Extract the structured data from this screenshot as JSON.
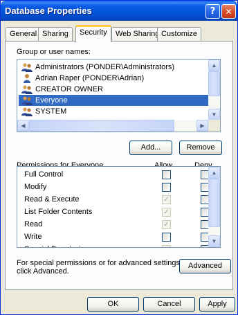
{
  "window": {
    "title": "Database Properties"
  },
  "titlebar": {
    "help_glyph": "?",
    "close_glyph": "✕"
  },
  "tabs": [
    "General",
    "Sharing",
    "Security",
    "Web Sharing",
    "Customize"
  ],
  "active_tab": "Security",
  "groups": {
    "label": "Group or user names:",
    "items": [
      {
        "name": "Administrators (PONDER\\Administrators)",
        "icon": "group-icon"
      },
      {
        "name": "Adrian Raper (PONDER\\Adrian)",
        "icon": "user-icon"
      },
      {
        "name": "CREATOR OWNER",
        "icon": "group-icon"
      },
      {
        "name": "Everyone",
        "icon": "group-icon",
        "selected": true
      },
      {
        "name": "SYSTEM",
        "icon": "group-icon"
      }
    ]
  },
  "buttons": {
    "add": "Add...",
    "remove": "Remove",
    "advanced": "Advanced",
    "ok": "OK",
    "cancel": "Cancel",
    "apply": "Apply"
  },
  "permissions": {
    "label": "Permissions for Everyone",
    "allow_header": "Allow",
    "deny_header": "Deny",
    "rows": [
      {
        "name": "Full Control",
        "allow": false,
        "allow_disabled": false,
        "deny": false
      },
      {
        "name": "Modify",
        "allow": false,
        "allow_disabled": false,
        "deny": false
      },
      {
        "name": "Read & Execute",
        "allow": true,
        "allow_disabled": true,
        "deny": false
      },
      {
        "name": "List Folder Contents",
        "allow": true,
        "allow_disabled": true,
        "deny": false
      },
      {
        "name": "Read",
        "allow": true,
        "allow_disabled": true,
        "deny": false
      },
      {
        "name": "Write",
        "allow": false,
        "allow_disabled": false,
        "deny": false
      },
      {
        "name": "Special Permissions",
        "allow": false,
        "allow_disabled": true,
        "deny": false
      }
    ]
  },
  "advanced_note": "For special permissions or for advanced settings, click Advanced.",
  "colors": {
    "titlebar": "#0A5CE6",
    "selection": "#316AC5",
    "dialog_bg": "#ECE9D8",
    "active_tab_accent": "#FFC83C"
  }
}
